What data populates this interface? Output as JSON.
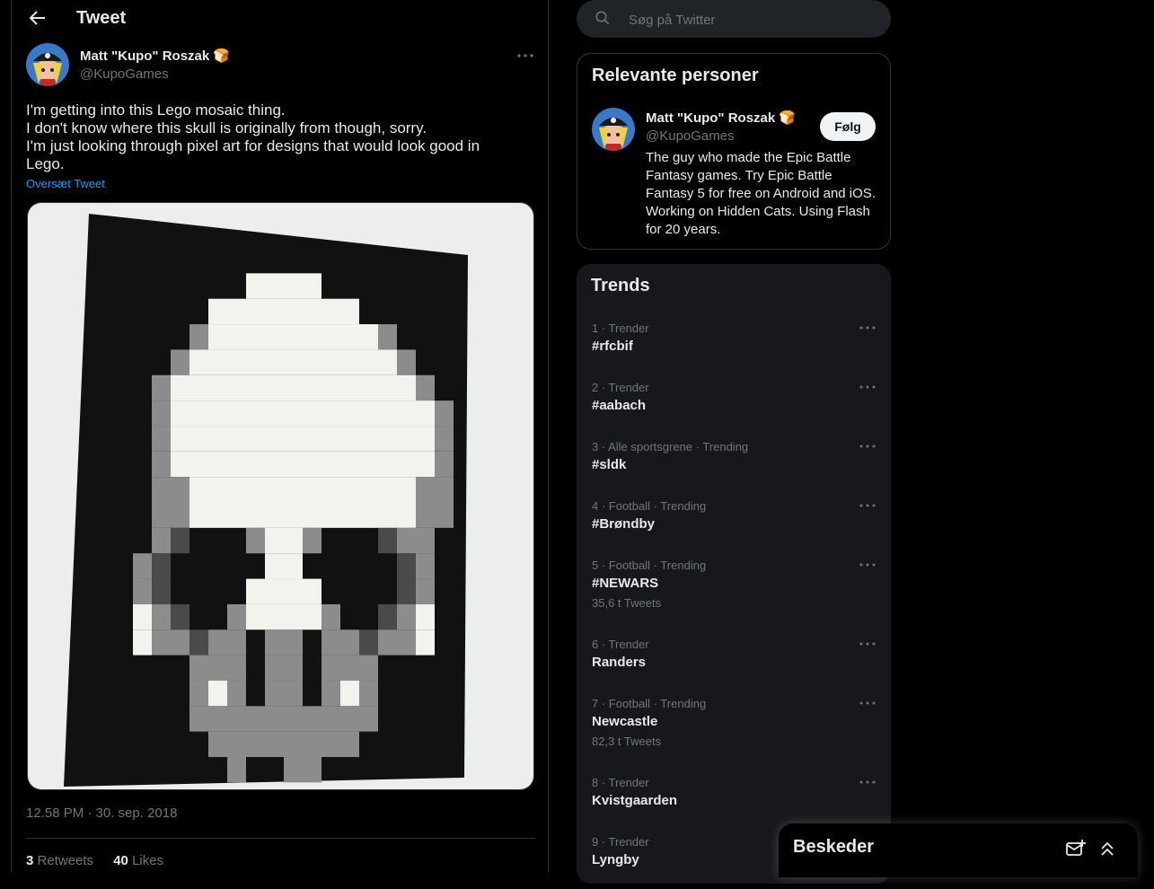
{
  "header": {
    "title": "Tweet"
  },
  "tweet": {
    "author_name": "Matt \"Kupo\" Roszak 🍞",
    "author_handle": "@KupoGames",
    "text_lines": [
      "I'm getting into this Lego mosaic thing.",
      "I don't know where this skull is originally from though, sorry.",
      "I'm just looking through pixel art for designs that would look good in",
      "Lego."
    ],
    "translate_label": "Oversæt Tweet",
    "timestamp": "12.58 PM · 30. sep. 2018",
    "retweets_count": "3",
    "retweets_label": "Retweets",
    "likes_count": "40",
    "likes_label": "Likes"
  },
  "search": {
    "placeholder": "Søg på Twitter"
  },
  "relevant": {
    "title": "Relevante personer",
    "name": "Matt \"Kupo\" Roszak 🍞",
    "handle": "@KupoGames",
    "follow_label": "Følg",
    "bio": "The guy who made the Epic Battle Fantasy games. Try Epic Battle Fantasy 5 for free on Android and iOS. Working on Hidden Cats. Using Flash for 20 years."
  },
  "trends": {
    "title": "Trends",
    "items": [
      {
        "meta": "1 · Trender",
        "name": "#rfcbif",
        "count": ""
      },
      {
        "meta": "2 · Trender",
        "name": "#aabach",
        "count": ""
      },
      {
        "meta": "3 · Alle sportsgrene · Trending",
        "name": "#sldk",
        "count": ""
      },
      {
        "meta": "4 · Football · Trending",
        "name": "#Brøndby",
        "count": ""
      },
      {
        "meta": "5 · Football · Trending",
        "name": "#NEWARS",
        "count": "35,6 t Tweets"
      },
      {
        "meta": "6 · Trender",
        "name": "Randers",
        "count": ""
      },
      {
        "meta": "7 · Football · Trending",
        "name": "Newcastle",
        "count": "82,3 t Tweets"
      },
      {
        "meta": "8 · Trender",
        "name": "Kvistgaarden",
        "count": ""
      },
      {
        "meta": "9 · Trender",
        "name": "Lyngby",
        "count": ""
      }
    ]
  },
  "messages": {
    "title": "Beskeder"
  },
  "colors": {
    "accent": "#1d9bf0",
    "background": "#000000",
    "panel": "#16181c"
  }
}
